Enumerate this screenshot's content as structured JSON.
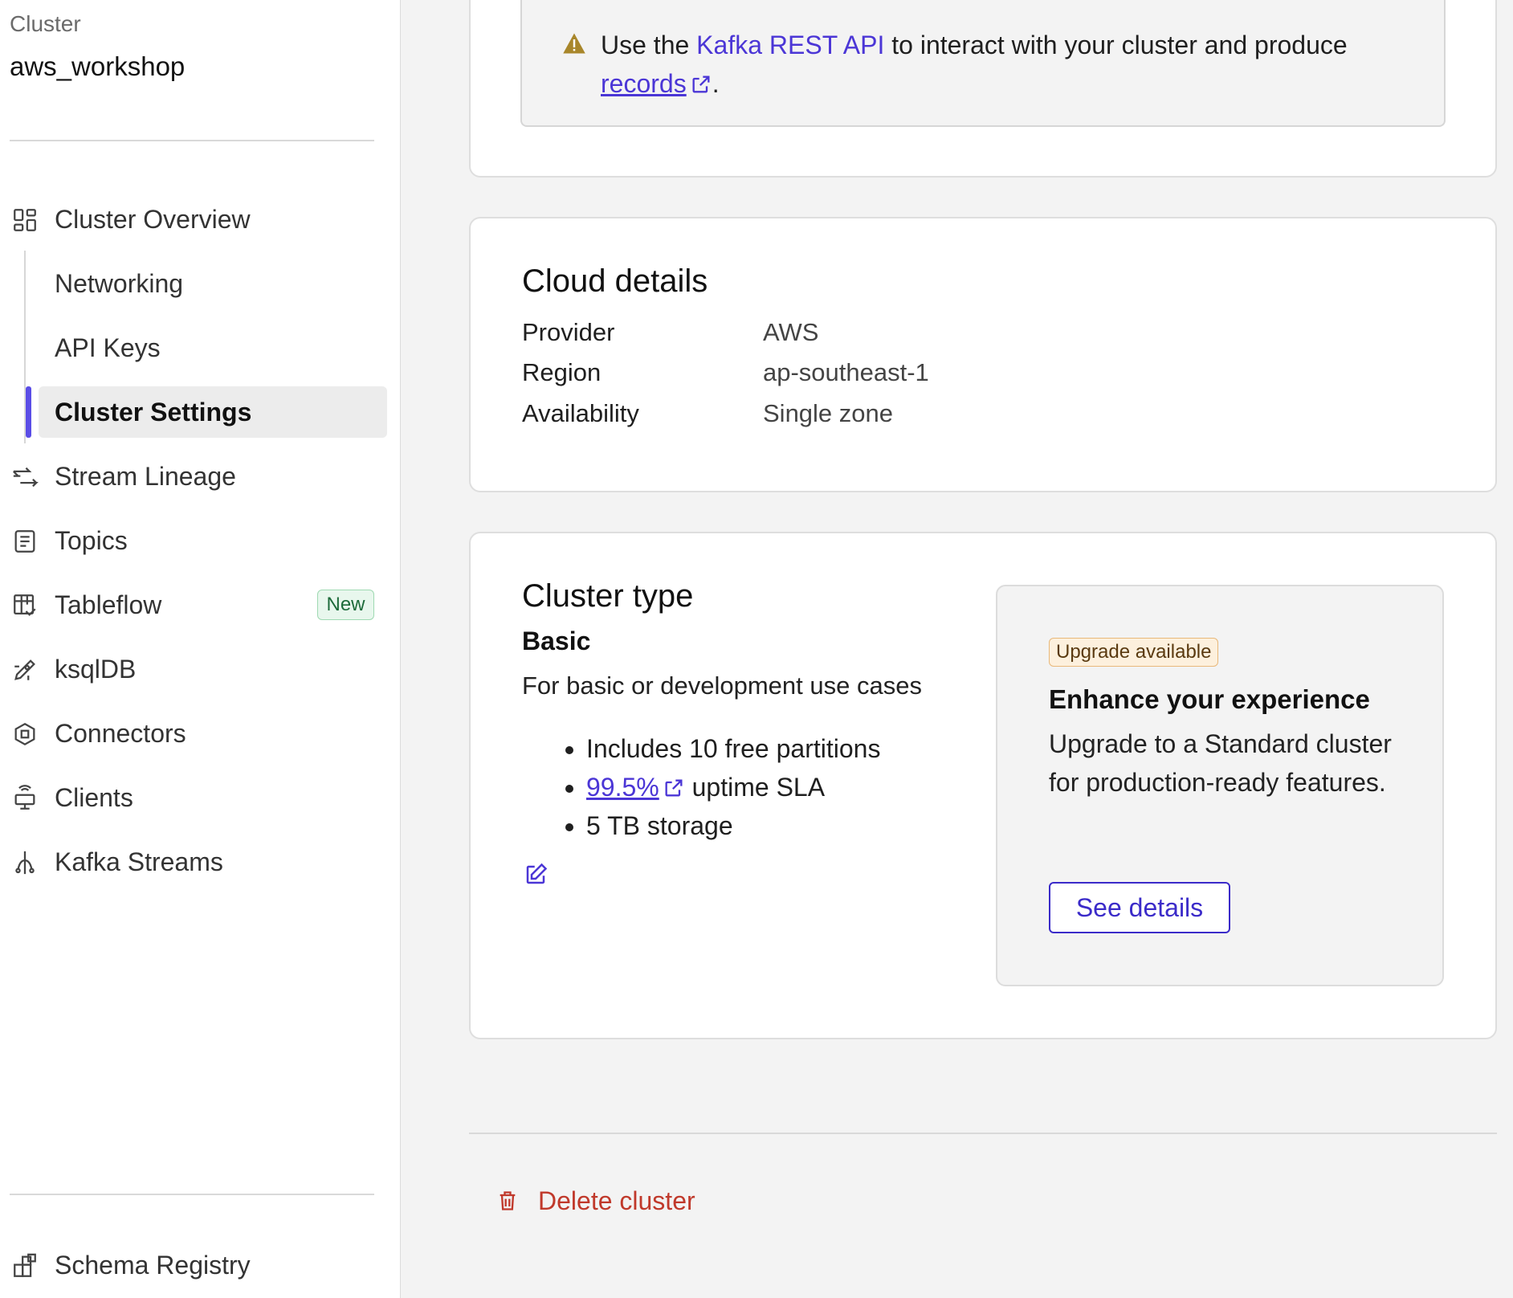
{
  "sidebar": {
    "cluster_label": "Cluster",
    "cluster_name": "aws_workshop",
    "items": [
      {
        "label": "Cluster Overview",
        "icon": "dashboard-icon"
      },
      {
        "label": "Networking"
      },
      {
        "label": "API Keys"
      },
      {
        "label": "Cluster Settings",
        "active": true
      },
      {
        "label": "Stream Lineage",
        "icon": "lineage-icon"
      },
      {
        "label": "Topics",
        "icon": "topics-icon"
      },
      {
        "label": "Tableflow",
        "icon": "tableflow-icon",
        "badge": "New"
      },
      {
        "label": "ksqlDB",
        "icon": "rocket-icon"
      },
      {
        "label": "Connectors",
        "icon": "connectors-icon"
      },
      {
        "label": "Clients",
        "icon": "clients-icon"
      },
      {
        "label": "Kafka Streams",
        "icon": "streams-icon"
      }
    ],
    "bottom_item": {
      "label": "Schema Registry",
      "icon": "schema-registry-icon"
    }
  },
  "notice": {
    "prefix": "Use the ",
    "link": "Kafka REST API",
    "middle": " to interact with your cluster and produce",
    "link2": "records",
    "suffix": "."
  },
  "cloud": {
    "title": "Cloud details",
    "rows": [
      {
        "key": "Provider",
        "value": "AWS"
      },
      {
        "key": "Region",
        "value": "ap-southeast-1"
      },
      {
        "key": "Availability",
        "value": "Single zone"
      }
    ]
  },
  "cluster_type": {
    "title": "Cluster type",
    "name": "Basic",
    "description": "For basic or development use cases",
    "bullets": {
      "b1": "Includes 10 free partitions",
      "b2_link": "99.5%",
      "b2_rest": "uptime SLA",
      "b3": "5 TB storage"
    }
  },
  "upgrade": {
    "badge": "Upgrade available",
    "title": "Enhance your experience",
    "body": "Upgrade to a Standard cluster for production-ready features.",
    "button": "See details"
  },
  "delete": {
    "label": "Delete cluster"
  },
  "colors": {
    "accent": "#5a4de6",
    "link": "#4b36d6",
    "danger": "#c0392b",
    "warning": "#a8862a"
  }
}
